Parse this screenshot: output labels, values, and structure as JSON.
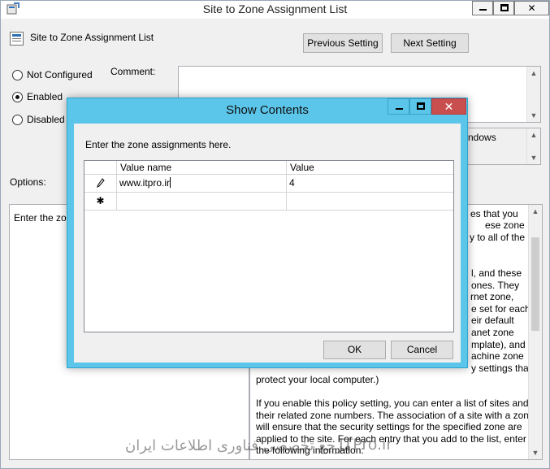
{
  "window": {
    "title": "Site to Zone Assignment List",
    "controls": {
      "minimize": "minimize",
      "maximize": "maximize",
      "close": "close"
    }
  },
  "header": {
    "policy_name": "Site to Zone Assignment List",
    "prev_button": "Previous Setting",
    "next_button": "Next Setting"
  },
  "state": {
    "options": [
      {
        "label": "Not Configured",
        "checked": false
      },
      {
        "label": "Enabled",
        "checked": true
      },
      {
        "label": "Disabled",
        "checked": false
      }
    ]
  },
  "comment": {
    "label": "Comment:",
    "value": ""
  },
  "supported": {
    "visible_text": "ndows"
  },
  "options_panel": {
    "label": "Options:",
    "visible_text": "Enter the zon"
  },
  "help": {
    "visible_lines_right": [
      "es that you",
      "ese zone",
      "y to all of the",
      "l, and these",
      "ones. They",
      "rnet zone,",
      "e set for each",
      "eir default",
      "anet zone",
      "mplate), and",
      "achine zone",
      "y settings that"
    ],
    "visible_lines_full": [
      "protect your local computer.)",
      "If you enable this policy setting, you can enter a list of sites and",
      "their related zone numbers. The association of a site with a zone",
      "will ensure that the security settings for the specified zone are",
      "applied to the site.  For each entry that you add to the list, enter",
      "the following information:"
    ]
  },
  "watermark": {
    "persian": "مرجع تخصصی فناوری اطلاعات ایران",
    "latin": "ITPro.ir"
  },
  "dialog": {
    "title": "Show Contents",
    "instruction": "Enter the zone assignments here.",
    "columns": [
      "Value name",
      "Value"
    ],
    "rows": [
      {
        "marker": "pencil",
        "name": "www.itpro.ir",
        "value": "4"
      },
      {
        "marker": "new-row",
        "name": "",
        "value": ""
      }
    ],
    "ok_button": "OK",
    "cancel_button": "Cancel"
  }
}
